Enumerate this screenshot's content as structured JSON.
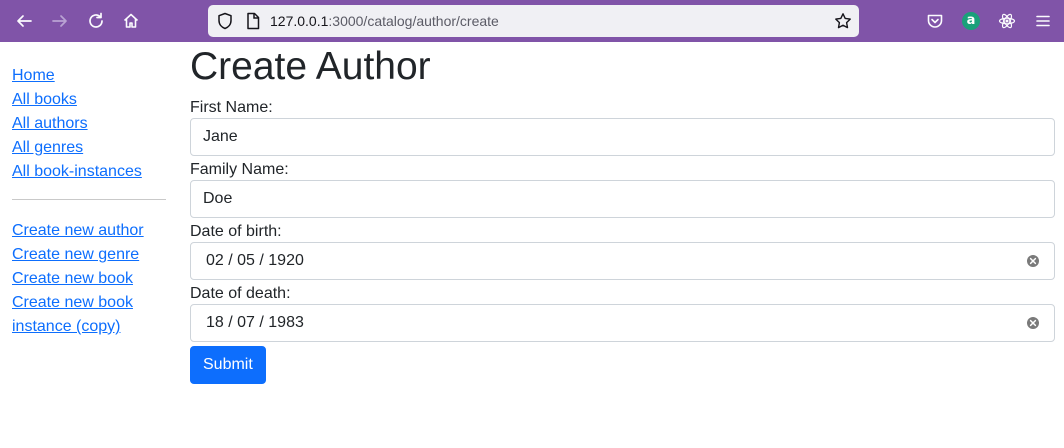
{
  "browser": {
    "url_host": "127.0.0.1",
    "url_path": ":3000/catalog/author/create",
    "extension_letter": "a",
    "colors": {
      "toolbar": "#8054a8",
      "urlbar": "#f0f0f4"
    }
  },
  "sidebar": {
    "links": [
      {
        "label": "Home"
      },
      {
        "label": "All books"
      },
      {
        "label": "All authors"
      },
      {
        "label": "All genres"
      },
      {
        "label": "All book-instances"
      }
    ],
    "create_links": [
      {
        "label": "Create new author"
      },
      {
        "label": "Create new genre"
      },
      {
        "label": "Create new book"
      },
      {
        "label": "Create new book instance (copy)"
      }
    ]
  },
  "form": {
    "title": "Create Author",
    "first_name": {
      "label": "First Name:",
      "value": "Jane"
    },
    "family_name": {
      "label": "Family Name:",
      "value": "Doe"
    },
    "date_of_birth": {
      "label": "Date of birth:",
      "value": "02 / 05 / 1920"
    },
    "date_of_death": {
      "label": "Date of death:",
      "value": "18 / 07 / 1983"
    },
    "submit_label": "Submit",
    "colors": {
      "primary": "#0d6efd",
      "link": "#0d6efd"
    }
  }
}
